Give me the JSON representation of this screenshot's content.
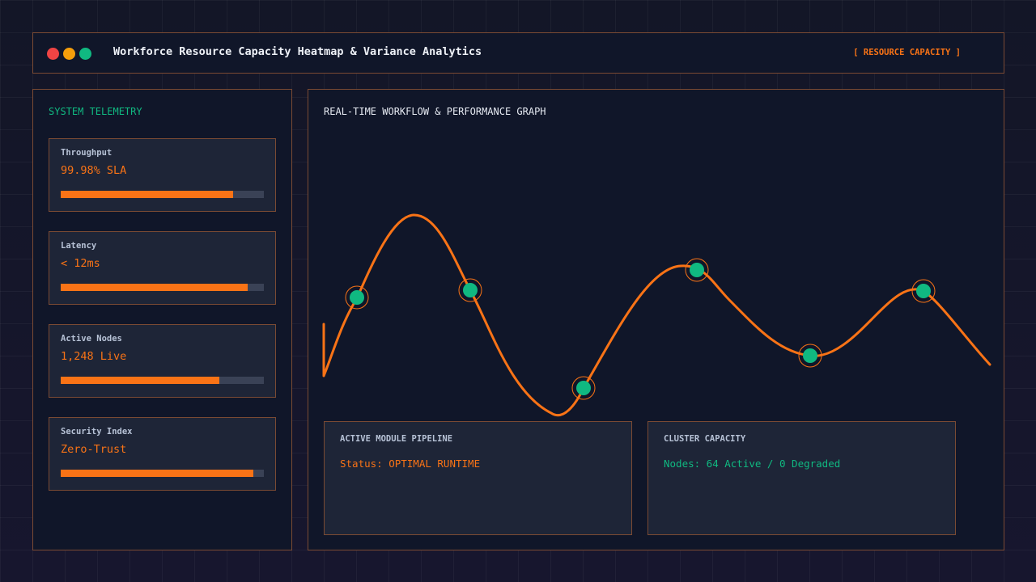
{
  "window": {
    "controls": [
      "close",
      "minimize",
      "maximize"
    ],
    "title": "Workforce Resource Capacity Heatmap & Variance Analytics",
    "tag": "[ RESOURCE CAPACITY ]"
  },
  "colors": {
    "accent": "#f97316",
    "success": "#10b981",
    "danger": "#ef4444",
    "warning": "#f59e0b",
    "panel": "#101629",
    "card": "#1e2537",
    "border": "#7a4a33"
  },
  "sidebar": {
    "title": "SYSTEM TELEMETRY",
    "metrics": [
      {
        "label": "Throughput",
        "value": "99.98% SLA",
        "level": 0.85
      },
      {
        "label": "Latency",
        "value": "< 12ms",
        "level": 0.92
      },
      {
        "label": "Active Nodes",
        "value": "1,248 Live",
        "level": 0.78
      },
      {
        "label": "Security Index",
        "value": "Zero-Trust",
        "level": 0.95
      }
    ]
  },
  "main": {
    "title": "REAL-TIME WORKFLOW & PERFORMANCE GRAPH",
    "pipeline": {
      "title": "ACTIVE MODULE PIPELINE",
      "status": "Status: OPTIMAL RUNTIME"
    },
    "capacity": {
      "title": "CLUSTER CAPACITY",
      "status": "Nodes: 64 Active / 0 Degraded"
    }
  }
}
